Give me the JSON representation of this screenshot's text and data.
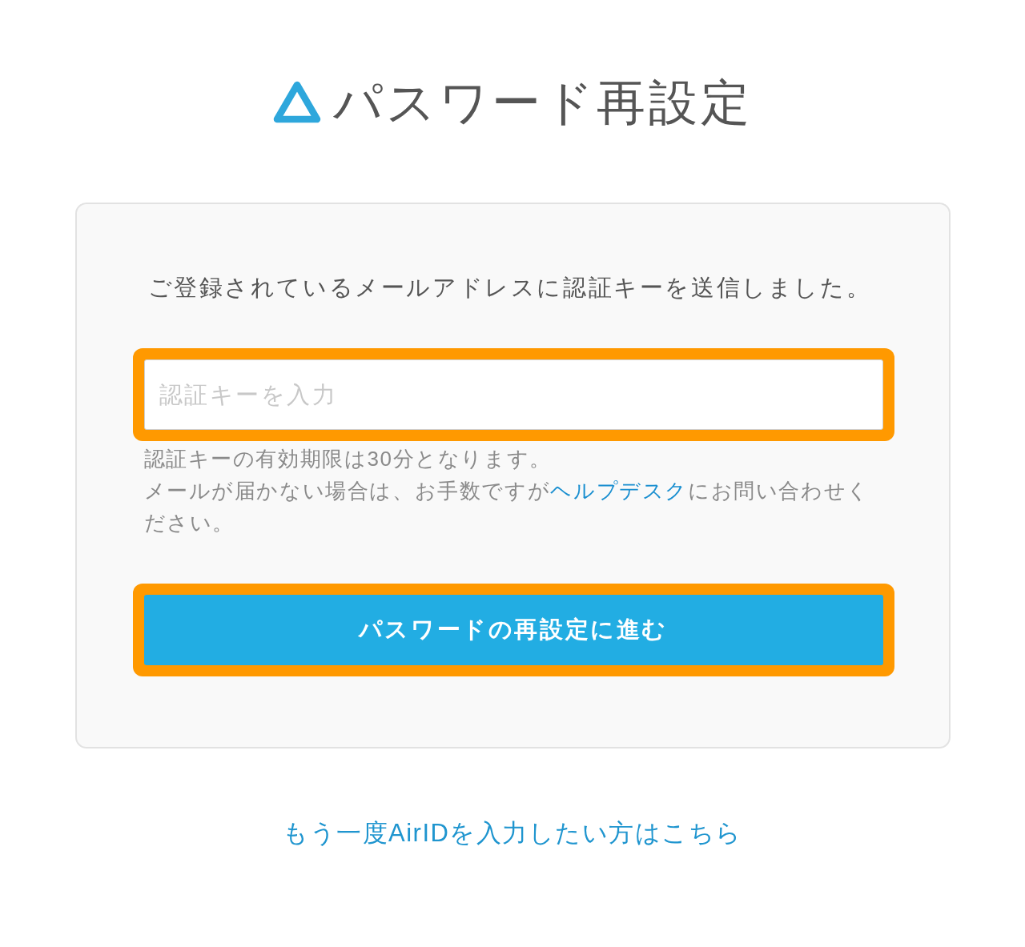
{
  "header": {
    "title": "パスワード再設定"
  },
  "card": {
    "message": "ご登録されているメールアドレスに認証キーを送信しました。",
    "key_field": {
      "placeholder": "認証キーを入力",
      "highlighted": true
    },
    "notes": [
      {
        "kind": "text",
        "text": "認証キーの有効期限は30分となります。"
      },
      {
        "kind": "link_sentence",
        "before": "メールが届かない場合は、お手数ですが",
        "link": "ヘルプデスク",
        "after": "にお問い合わせください。"
      }
    ],
    "submit_button": {
      "label": "パスワードの再設定に進む",
      "highlighted": true
    }
  },
  "footer_link": {
    "label": "もう一度AirIDを入力したい方はこちら"
  }
}
